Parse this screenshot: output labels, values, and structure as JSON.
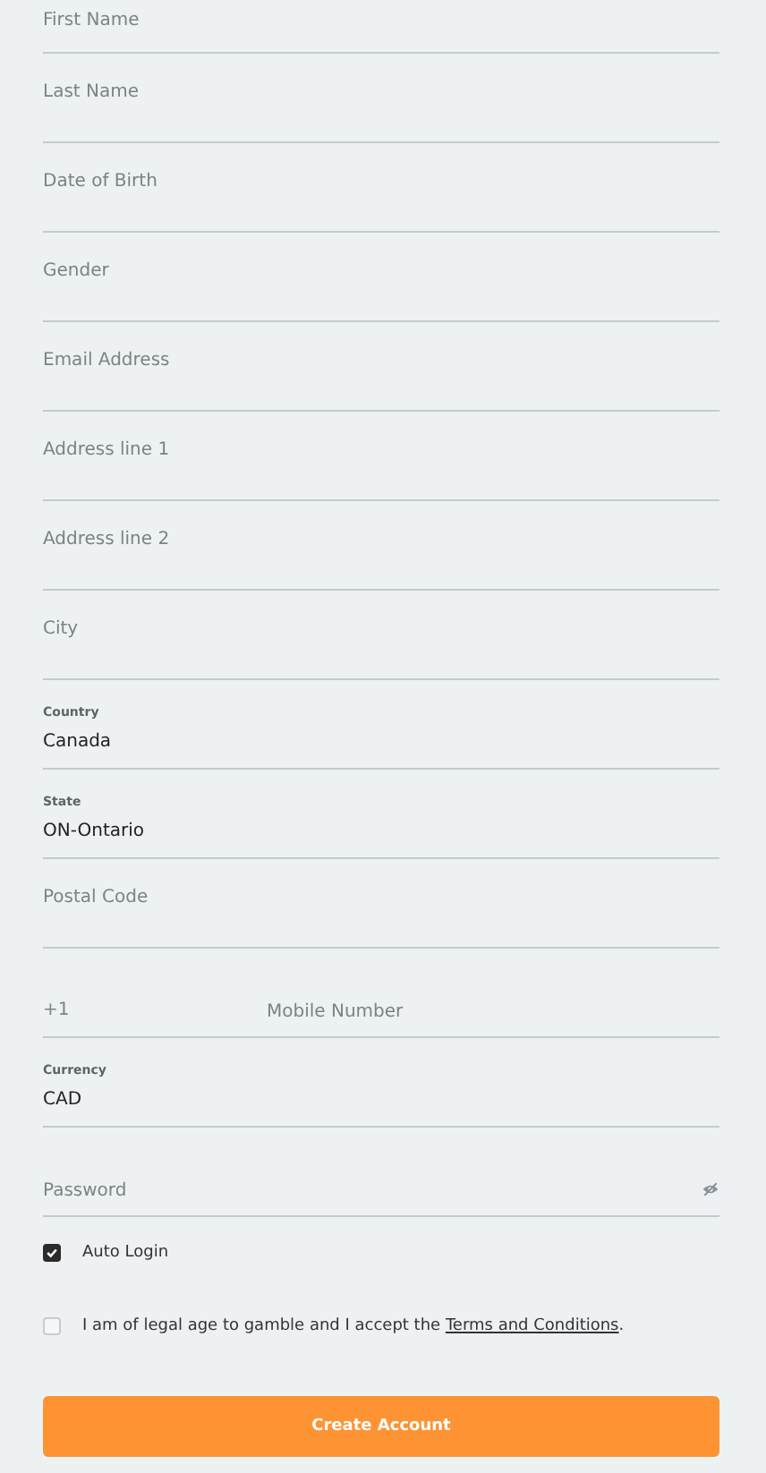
{
  "fields": [
    {
      "kind": "text",
      "placeholder": "First Name"
    },
    {
      "kind": "text",
      "placeholder": "Last Name"
    },
    {
      "kind": "text",
      "placeholder": "Date of Birth"
    },
    {
      "kind": "text",
      "placeholder": "Gender"
    },
    {
      "kind": "text",
      "placeholder": "Email Address"
    },
    {
      "kind": "text",
      "placeholder": "Address line 1"
    },
    {
      "kind": "text",
      "placeholder": "Address line 2"
    },
    {
      "kind": "text",
      "placeholder": "City"
    },
    {
      "kind": "select",
      "label": "Country",
      "value": "Canada"
    },
    {
      "kind": "select",
      "label": "State",
      "value": "ON-Ontario"
    },
    {
      "kind": "text",
      "placeholder": "Postal Code"
    },
    {
      "kind": "phone",
      "prefix": "+1",
      "placeholder": "Mobile Number"
    },
    {
      "kind": "select",
      "label": "Currency",
      "value": "CAD"
    },
    {
      "kind": "password",
      "placeholder": "Password"
    }
  ],
  "checkboxes": [
    {
      "text": "Auto Login",
      "checked": true
    },
    {
      "text": "I am of legal age to gamble and I accept the",
      "link": "Terms and Conditions",
      "after": ".",
      "checked": false
    }
  ],
  "button": "Create Account"
}
